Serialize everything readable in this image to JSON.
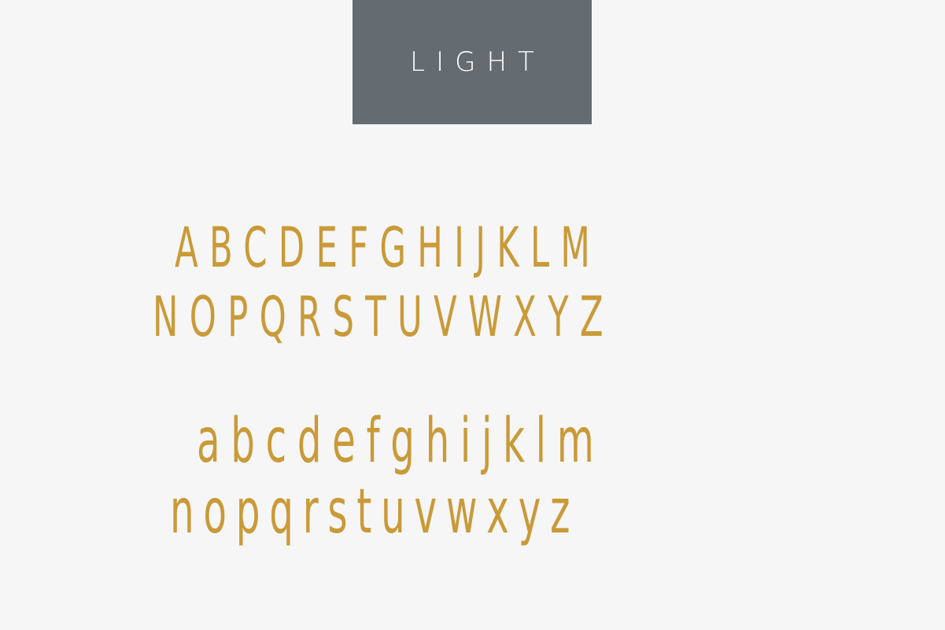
{
  "header": {
    "weight_label": "LIGHT"
  },
  "specimen": {
    "uppercase": [
      "ABCDEFGHIJKLM",
      "NOPQRSTUVWXYZ"
    ],
    "lowercase": [
      "abcdefghijklm",
      "nopqrstuvwxyz"
    ]
  },
  "colors": {
    "background": "#f6f6f6",
    "badge": "#656c71",
    "glyph": "#c99a38"
  }
}
